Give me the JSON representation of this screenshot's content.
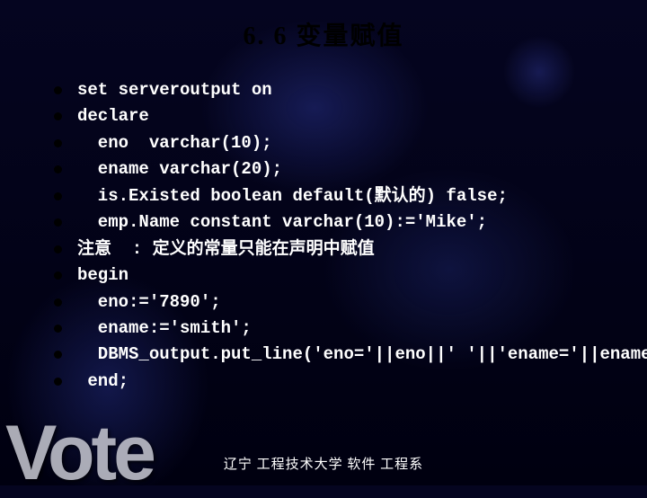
{
  "title": "6. 6    变量赋值",
  "lines": [
    "set serveroutput on",
    "declare",
    "  eno  varchar(10);",
    "  ename varchar(20);",
    "  is.Existed boolean default(默认的) false;",
    "  emp.Name constant varchar(10):='Mike';",
    "注意  : 定义的常量只能在声明中赋值",
    "begin",
    "  eno:='7890';",
    "  ename:='smith';",
    "  DBMS_output.put_line('eno='||eno||' '||'ename='||ename);",
    " end;"
  ],
  "footer": "辽宁 工程技术大学 软件 工程系",
  "watermark": "Vote"
}
